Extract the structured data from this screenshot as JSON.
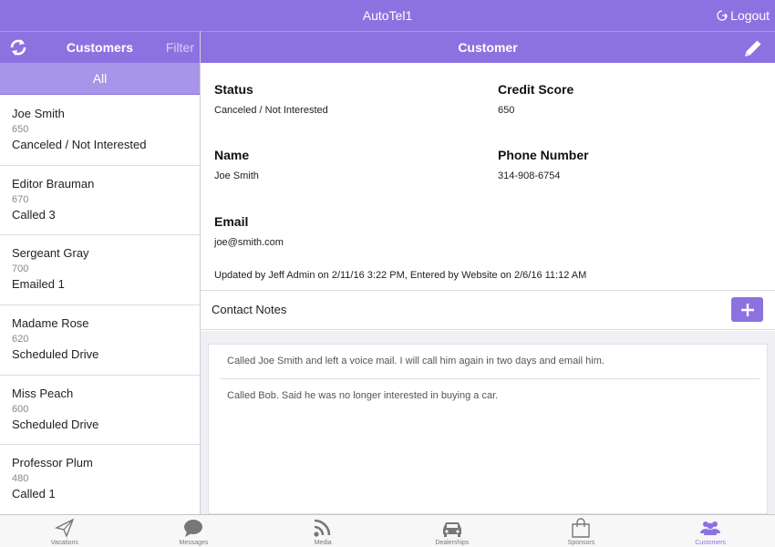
{
  "app": {
    "title": "AutoTel1",
    "logout_label": "Logout"
  },
  "left_panel": {
    "title": "Customers",
    "filter_label": "Filter",
    "all_tab": "All"
  },
  "customers": [
    {
      "name": "Joe Smith",
      "credit": "650",
      "status": "Canceled / Not Interested"
    },
    {
      "name": "Editor Brauman",
      "credit": "670",
      "status": "Called 3"
    },
    {
      "name": "Sergeant Gray",
      "credit": "700",
      "status": "Emailed 1"
    },
    {
      "name": "Madame Rose",
      "credit": "620",
      "status": "Scheduled Drive"
    },
    {
      "name": "Miss Peach",
      "credit": "600",
      "status": "Scheduled Drive"
    },
    {
      "name": "Professor Plum",
      "credit": "480",
      "status": "Called 1"
    }
  ],
  "detail": {
    "title": "Customer",
    "status_label": "Status",
    "status_value": "Canceled / Not Interested",
    "credit_label": "Credit Score",
    "credit_value": "650",
    "name_label": "Name",
    "name_value": "Joe Smith",
    "phone_label": "Phone Number",
    "phone_value": "314-908-6754",
    "email_label": "Email",
    "email_value": "joe@smith.com",
    "updated": "Updated by Jeff Admin on 2/11/16 3:22 PM, Entered by Website on 2/6/16 11:12 AM"
  },
  "notes": {
    "title": "Contact Notes",
    "items": [
      "Called Joe Smith and left a voice mail. I will call him again in two days and email him.",
      "Called Bob. Said he was no longer interested in buying a car."
    ]
  },
  "tabs": [
    {
      "label": "Vacations",
      "icon": "paper-plane-icon"
    },
    {
      "label": "Messages",
      "icon": "chat-bubble-icon"
    },
    {
      "label": "Media",
      "icon": "rss-icon"
    },
    {
      "label": "Dealerships",
      "icon": "car-icon"
    },
    {
      "label": "Sponsors",
      "icon": "shopping-bag-icon"
    },
    {
      "label": "Customers",
      "icon": "people-icon",
      "active": true
    }
  ],
  "colors": {
    "accent": "#8c72e0",
    "accent_light": "#a795e9"
  }
}
